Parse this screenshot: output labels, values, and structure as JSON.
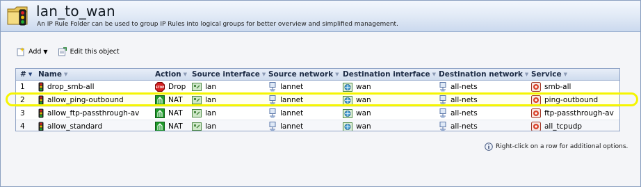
{
  "header": {
    "title": "lan_to_wan",
    "subtitle": "An IP Rule Folder can be used to group IP Rules into logical groups for better overview and simplified management."
  },
  "toolbar": {
    "add_label": "Add",
    "edit_label": "Edit this object"
  },
  "table": {
    "columns": {
      "num": "#",
      "name": "Name",
      "action": "Action",
      "src_if": "Source interface",
      "src_net": "Source network",
      "dst_if": "Destination interface",
      "dst_net": "Destination network",
      "service": "Service"
    },
    "rows": [
      {
        "num": "1",
        "name": "drop_smb-all",
        "action": "Drop",
        "src_if": "lan",
        "src_net": "lannet",
        "dst_if": "wan",
        "dst_net": "all-nets",
        "service": "smb-all"
      },
      {
        "num": "2",
        "name": "allow_ping-outbound",
        "action": "NAT",
        "src_if": "lan",
        "src_net": "lannet",
        "dst_if": "wan",
        "dst_net": "all-nets",
        "service": "ping-outbound"
      },
      {
        "num": "3",
        "name": "allow_ftp-passthrough-av",
        "action": "NAT",
        "src_if": "lan",
        "src_net": "lannet",
        "dst_if": "wan",
        "dst_net": "all-nets",
        "service": "ftp-passthrough-av"
      },
      {
        "num": "4",
        "name": "allow_standard",
        "action": "NAT",
        "src_if": "lan",
        "src_net": "lannet",
        "dst_if": "wan",
        "dst_net": "all-nets",
        "service": "all_tcpudp"
      }
    ],
    "highlighted_row": 2
  },
  "hint": "Right-click on a row for additional options.",
  "colors": {
    "highlight": "#f5f500",
    "drop": "#d42020",
    "nat": "#1f9a2a"
  }
}
